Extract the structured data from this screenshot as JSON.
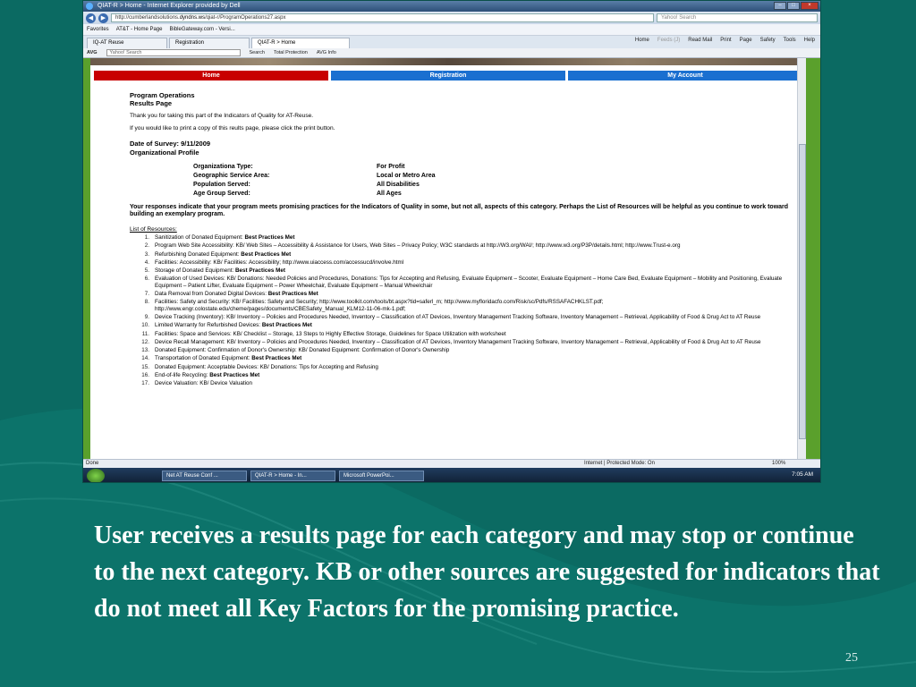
{
  "browser": {
    "title": "QIAT-R > Home - Internet Explorer provided by Dell",
    "url_prefix": "http://cumberlandsolutions.",
    "url_domain": "dyndns.ws",
    "url_path": "/qiat-r/ProgramOperations27.aspx",
    "search_placeholder": "Yahoo! Search",
    "favorites_label": "Favorites",
    "favorites_links": [
      "AT&T - Home Page",
      "BibleGateway.com - Versi..."
    ],
    "tabs": [
      "IQ-AT Reuse",
      "Registration",
      "QIAT-R > Home"
    ],
    "commands": [
      "Home",
      "Feeds (J)",
      "Read Mail",
      "Print",
      "Page",
      "Safety",
      "Tools",
      "Help"
    ],
    "toolbar": {
      "avg": "AVG",
      "search_placeholder": "Yahoo! Search",
      "search_btn": "Search",
      "total_protection": "Total Protection",
      "avg_info": "AVG Info"
    },
    "status_done": "Done",
    "status_zone": "Internet | Protected Mode: On",
    "zoom": "100%"
  },
  "site_nav": {
    "home": "Home",
    "registration": "Registration",
    "my_account": "My Account"
  },
  "content": {
    "title1": "Program Operations",
    "title2": "Results Page",
    "thanks": "Thank you for taking this part of the Indicators of Quality for AT-Reuse.",
    "print_note": "If you would like to print a copy of this reults page, please click the print button.",
    "survey_date": "Date of Survey: 9/11/2009",
    "org_profile": "Organizational Profile",
    "profile": [
      {
        "label": "Organizationa Type:",
        "value": "For Profit"
      },
      {
        "label": "Geographic Service Area:",
        "value": "Local or Metro Area"
      },
      {
        "label": "Population Served:",
        "value": "All Disabilities"
      },
      {
        "label": "Age Group Served:",
        "value": "All Ages"
      }
    ],
    "responses": "Your responses indicate that your program meets promising practices for the Indicators of Quality in some, but not all, aspects of this category. Perhaps the List of Resources will be helpful as you continue to work toward building an exemplary program.",
    "list_title": "List of Resources:",
    "resources": [
      {
        "n": "1.",
        "text": "Sanitization of Donated Equipment: ",
        "bold": "Best Practices Met"
      },
      {
        "n": "2.",
        "text": "Program Web Site Accessibility: KB/ Web Sites – Accessibility & Assistance for Users, Web Sites – Privacy Policy; W3C standards at http://W3.org/WAI/; http://www.w3.org/P3P/details.html; http://www.Trust-e.org",
        "bold": ""
      },
      {
        "n": "3.",
        "text": "Refurbishing Donated Equipment: ",
        "bold": "Best Practices Met"
      },
      {
        "n": "4.",
        "text": "Facilities: Accessibility: KB/ Facilities: Accessibility; http://www.uiaccess.com/accessucd/involve.html",
        "bold": ""
      },
      {
        "n": "5.",
        "text": "Storage of Donated Equipment: ",
        "bold": "Best Practices Met"
      },
      {
        "n": "6.",
        "text": "Evaluation of Used Devices: KB/ Donations: Needed Policies and Procedures, Donations: Tips for Accepting and Refusing, Evaluate Equipment – Scooter, Evaluate Equipment – Home Care Bed, Evaluate Equipment – Mobility and Positioning, Evaluate Equipment – Patient Lifter, Evaluate Equipment – Power Wheelchair, Evaluate Equipment – Manual Wheelchair",
        "bold": ""
      },
      {
        "n": "7.",
        "text": "Data Removal from Donated Digital Devices: ",
        "bold": "Best Practices Met"
      },
      {
        "n": "8.",
        "text": "Facilities: Safety and Security: KB/ Facilities: Safety and Security; http://www.toolkit.com/tools/bt.aspx?tid=saferl_m; http://www.myfloridacfo.com/Risk/sc/Pdfs/RSSAFACHKLST.pdf; http://www.engr.colostate.edu/cheme/pages/documents/CBESafety_Manual_KLM12-11-06-mk-1.pdf;",
        "bold": ""
      },
      {
        "n": "9.",
        "text": "Device Tracking (Inventory): KB/ Inventory – Policies and Procedures Needed, Inventory – Classification of AT Devices, Inventory Management Tracking Software, Inventory Management – Retrieval, Applicability of Food & Drug Act to AT Reuse",
        "bold": ""
      },
      {
        "n": "10.",
        "text": "Limited Warranty for Refurbished Devices: ",
        "bold": "Best Practices Met"
      },
      {
        "n": "11.",
        "text": "Facilities: Space and Services: KB/ Checklist – Storage, 13 Steps to Highly Effective Storage, Guidelines for Space Utilization with worksheet",
        "bold": ""
      },
      {
        "n": "12.",
        "text": "Device Recall Management: KB/ Inventory – Policies and Procedures Needed, Inventory – Classification of AT Devices, Inventory Management Tracking Software, Inventory Management – Retrieval, Applicability of Food & Drug Act to AT Reuse",
        "bold": ""
      },
      {
        "n": "13.",
        "text": "Donated Equipment: Confirmation of Donor's Ownership: KB/ Donated Equipment: Confirmation of Donor's Ownership",
        "bold": ""
      },
      {
        "n": "14.",
        "text": "Transportation of Donated Equipment: ",
        "bold": "Best Practices Met"
      },
      {
        "n": "15.",
        "text": "Donated Equipment: Acceptable Devices: KB/ Donations: Tips for Accepting and Refusing",
        "bold": ""
      },
      {
        "n": "16.",
        "text": "End-of-life Recycling: ",
        "bold": "Best Practices Met"
      },
      {
        "n": "17.",
        "text": "Device Valuation: KB/ Device Valuation",
        "bold": ""
      }
    ]
  },
  "taskbar": {
    "items": [
      "Net AT Reuse Conf ...",
      "QIAT-R > Home - In...",
      "Microsoft PowerPoi..."
    ],
    "clock": "7:05 AM"
  },
  "slide": {
    "caption": "User receives a results page for each category and may stop or continue to the next category. KB or other sources are suggested for indicators that do not meet all Key Factors for the promising practice.",
    "number": "25"
  },
  "colors": {
    "background": "#0b6a62",
    "nav_home": "#c80000",
    "nav_blue": "#1a6fd0",
    "page_border": "#5aa02c"
  }
}
